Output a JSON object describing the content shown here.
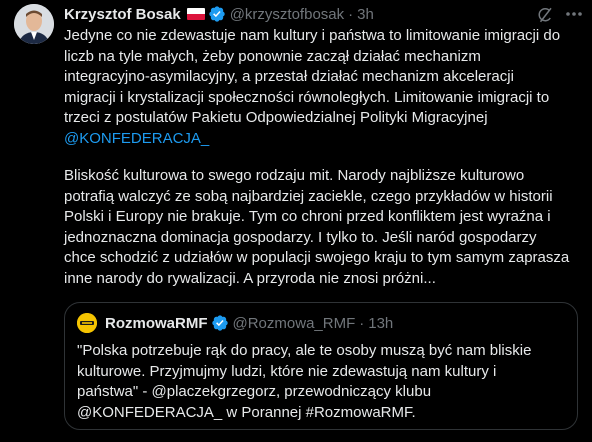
{
  "colors": {
    "background": "#000000",
    "text": "#e7e9ea",
    "secondary_text": "#71767b",
    "link": "#1d9bf0",
    "verified_badge": "#1d9bf0",
    "border": "#2f3336",
    "quote_avatar_bg": "#f5c400"
  },
  "tweet": {
    "author_name": "Krzysztof Bosak",
    "flag": "poland-flag-icon",
    "verified": true,
    "handle": "@krzysztofbosak",
    "separator": "·",
    "time": "3h",
    "paragraph1": "Jedyne co nie zdewastuje nam kultury i państwa to limitowanie imigracji do\nliczb na tyle małych, żeby ponownie zaczął działać mechanizm\nintegracyjno-asymilacyjny, a przestał działać mechanizm akceleracji\nmigracji i krystalizacji społeczności równoległych. Limitowanie imigracji to\ntrzeci z postulatów Pakietu Odpowiedzialnej Polityki Migracyjnej",
    "mention1": "@KONFEDERACJA_",
    "paragraph2": "Bliskość kulturowa to swego rodzaju mit. Narody najbliższe kulturowo\npotrafią walczyć ze sobą najbardziej zaciekle, czego przykładów w historii\nPolski i Europy nie brakuje. Tym co chroni przed konfliktem jest wyraźna i\njednoznaczna dominacja gospodarzy. I tylko to. Jeśli naród gospodarzy\nchce schodzić z udziałów w populacji swojego kraju to tym samym zaprasza\ninne narody do rywalizacji. A przyroda nie znosi próżni..."
  },
  "quote": {
    "author_name": "RozmowaRMF",
    "verified": true,
    "handle": "@Rozmowa_RMF",
    "separator": "·",
    "time": "13h",
    "text": "\"Polska potrzebuje rąk do pracy, ale te osoby muszą być nam bliskie\nkulturowe. Przyjmujmy ludzi, które nie zdewastują nam kultury i\npaństwa\" - @placzekgrzegorz, przewodniczący klubu\n@KONFEDERACJA_ w Porannej #RozmowaRMF."
  },
  "icons": {
    "grok": "grok-icon",
    "more": "more-options-icon"
  }
}
